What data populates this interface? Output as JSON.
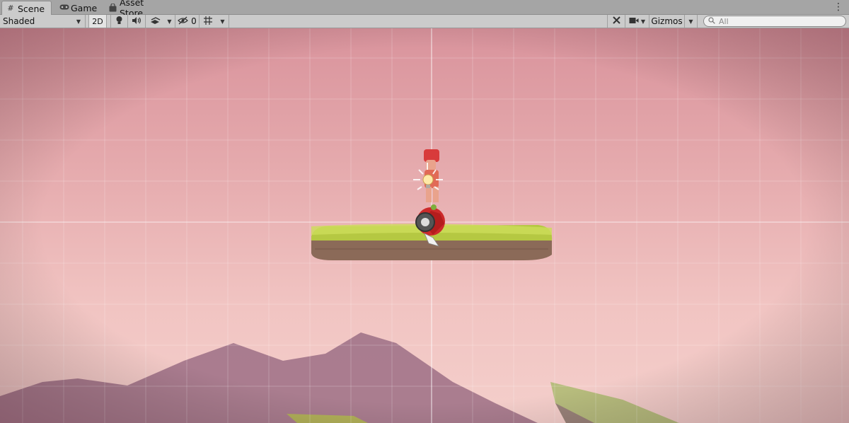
{
  "tabs": [
    {
      "label": "Scene",
      "icon": "grid-icon",
      "active": true
    },
    {
      "label": "Game",
      "icon": "gamepad-icon",
      "active": false
    },
    {
      "label": "Asset Store",
      "icon": "shopping-bag-icon",
      "active": false
    }
  ],
  "toolbar": {
    "draw_mode": "Shaded",
    "mode_2d_label": "2D",
    "hidden_count": "0",
    "gizmos_label": "Gizmos",
    "search_placeholder": "All"
  },
  "colors": {
    "sky_top": "#d9939c",
    "sky_bottom": "#f4cfcb",
    "grass": "#b5c842",
    "dirt": "#8b6a58",
    "mountain": "#9c6f85"
  }
}
